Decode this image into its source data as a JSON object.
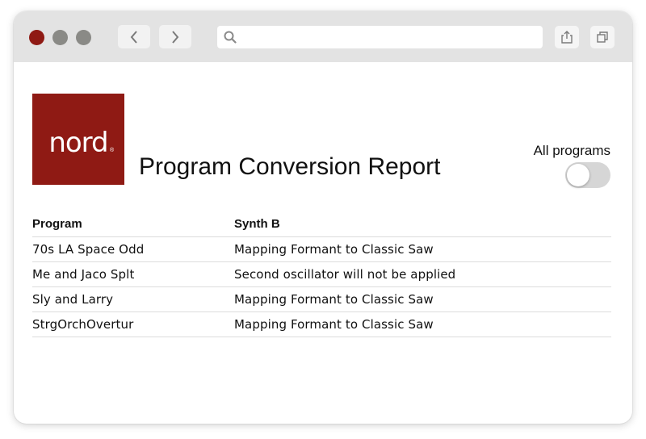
{
  "colors": {
    "brand_red": "#8f1a14",
    "traffic_red": "#8f1a14",
    "traffic_gray": "#8a8a86",
    "titlebar": "#e3e3e3",
    "toggle_off": "#d6d6d6"
  },
  "browser": {
    "url_value": "",
    "icons": {
      "back": "chevron-left-icon",
      "forward": "chevron-right-icon",
      "search": "search-icon",
      "share": "share-icon",
      "tabs": "tabs-icon"
    }
  },
  "logo": {
    "text": "nord",
    "reg": "®"
  },
  "page": {
    "title": "Program Conversion Report"
  },
  "filter": {
    "label": "All programs",
    "enabled": false
  },
  "table": {
    "headers": [
      "Program",
      "Synth B"
    ],
    "rows": [
      [
        "70s LA Space Odd",
        "Mapping Formant to Classic Saw"
      ],
      [
        "Me and Jaco Splt",
        "Second oscillator will not be applied"
      ],
      [
        "Sly and Larry",
        "Mapping Formant to Classic Saw"
      ],
      [
        "StrgOrchOvertur",
        "Mapping Formant to Classic Saw"
      ]
    ]
  }
}
